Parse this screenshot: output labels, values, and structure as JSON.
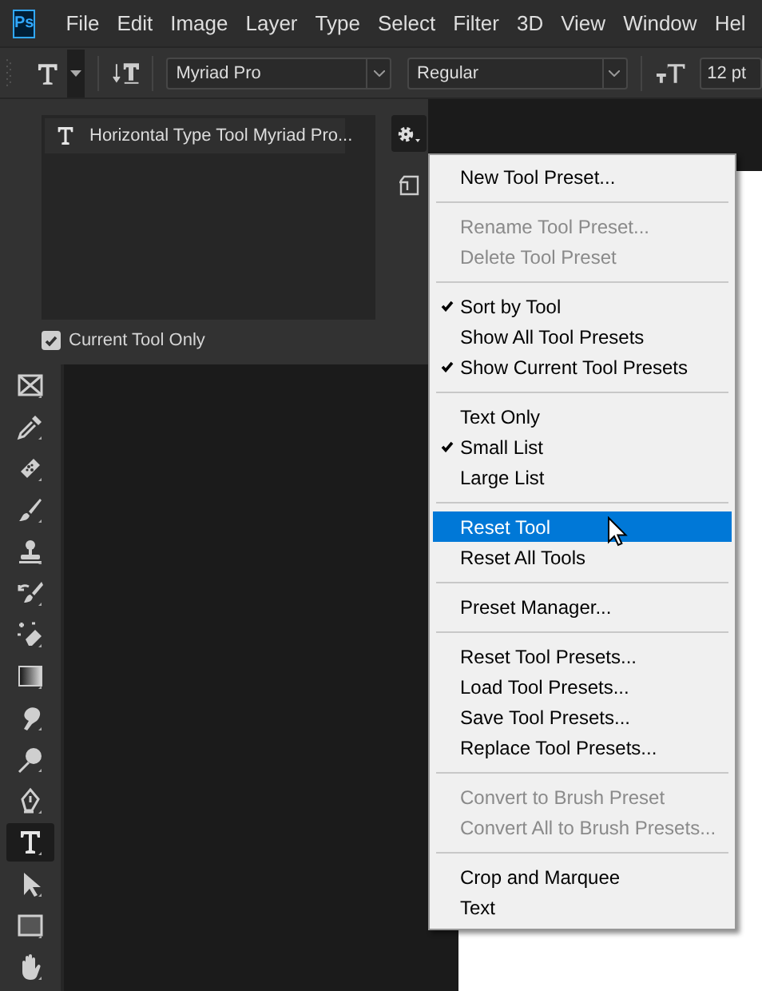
{
  "menubar": {
    "logo": "Ps",
    "items": [
      "File",
      "Edit",
      "Image",
      "Layer",
      "Type",
      "Select",
      "Filter",
      "3D",
      "View",
      "Window",
      "Hel"
    ]
  },
  "options_bar": {
    "font_family": "Myriad Pro",
    "font_style": "Regular",
    "font_size": "12 pt"
  },
  "toolbar": {
    "tools": [
      {
        "kind": "frame",
        "selected": false
      },
      {
        "kind": "eyedropper",
        "selected": false
      },
      {
        "kind": "bandage",
        "selected": false
      },
      {
        "kind": "brush",
        "selected": false
      },
      {
        "kind": "stamp",
        "selected": false
      },
      {
        "kind": "history-brush",
        "selected": false
      },
      {
        "kind": "eraser",
        "selected": false
      },
      {
        "kind": "gradient",
        "selected": false
      },
      {
        "kind": "finger",
        "selected": false
      },
      {
        "kind": "dodge",
        "selected": false
      },
      {
        "kind": "pen",
        "selected": false
      },
      {
        "kind": "type",
        "selected": true
      },
      {
        "kind": "arrow",
        "selected": false
      },
      {
        "kind": "rectangle",
        "selected": false
      },
      {
        "kind": "hand",
        "selected": false
      }
    ]
  },
  "presets_panel": {
    "presets": [
      {
        "label": "Horizontal Type Tool Myriad Pro..."
      }
    ],
    "current_tool_only": {
      "label": "Current Tool Only",
      "checked": true
    }
  },
  "panel_menu": {
    "items": [
      {
        "kind": "item",
        "label": "New Tool Preset...",
        "checked": false,
        "disabled": false,
        "selected": false
      },
      {
        "kind": "separator"
      },
      {
        "kind": "item",
        "label": "Rename Tool Preset...",
        "checked": false,
        "disabled": true,
        "selected": false
      },
      {
        "kind": "item",
        "label": "Delete Tool Preset",
        "checked": false,
        "disabled": true,
        "selected": false
      },
      {
        "kind": "separator"
      },
      {
        "kind": "item",
        "label": "Sort by Tool",
        "checked": true,
        "disabled": false,
        "selected": false
      },
      {
        "kind": "item",
        "label": "Show All Tool Presets",
        "checked": false,
        "disabled": false,
        "selected": false
      },
      {
        "kind": "item",
        "label": "Show Current Tool Presets",
        "checked": true,
        "disabled": false,
        "selected": false
      },
      {
        "kind": "separator"
      },
      {
        "kind": "item",
        "label": "Text Only",
        "checked": false,
        "disabled": false,
        "selected": false
      },
      {
        "kind": "item",
        "label": "Small List",
        "checked": true,
        "disabled": false,
        "selected": false
      },
      {
        "kind": "item",
        "label": "Large List",
        "checked": false,
        "disabled": false,
        "selected": false
      },
      {
        "kind": "separator"
      },
      {
        "kind": "item",
        "label": "Reset Tool",
        "checked": false,
        "disabled": false,
        "selected": true
      },
      {
        "kind": "item",
        "label": "Reset All Tools",
        "checked": false,
        "disabled": false,
        "selected": false
      },
      {
        "kind": "separator"
      },
      {
        "kind": "item",
        "label": "Preset Manager...",
        "checked": false,
        "disabled": false,
        "selected": false
      },
      {
        "kind": "separator"
      },
      {
        "kind": "item",
        "label": "Reset Tool Presets...",
        "checked": false,
        "disabled": false,
        "selected": false
      },
      {
        "kind": "item",
        "label": "Load Tool Presets...",
        "checked": false,
        "disabled": false,
        "selected": false
      },
      {
        "kind": "item",
        "label": "Save Tool Presets...",
        "checked": false,
        "disabled": false,
        "selected": false
      },
      {
        "kind": "item",
        "label": "Replace Tool Presets...",
        "checked": false,
        "disabled": false,
        "selected": false
      },
      {
        "kind": "separator"
      },
      {
        "kind": "item",
        "label": "Convert to Brush Preset",
        "checked": false,
        "disabled": true,
        "selected": false
      },
      {
        "kind": "item",
        "label": "Convert All to Brush Presets...",
        "checked": false,
        "disabled": true,
        "selected": false
      },
      {
        "kind": "separator"
      },
      {
        "kind": "item",
        "label": "Crop and Marquee",
        "checked": false,
        "disabled": false,
        "selected": false
      },
      {
        "kind": "item",
        "label": "Text",
        "checked": false,
        "disabled": false,
        "selected": false
      }
    ]
  }
}
